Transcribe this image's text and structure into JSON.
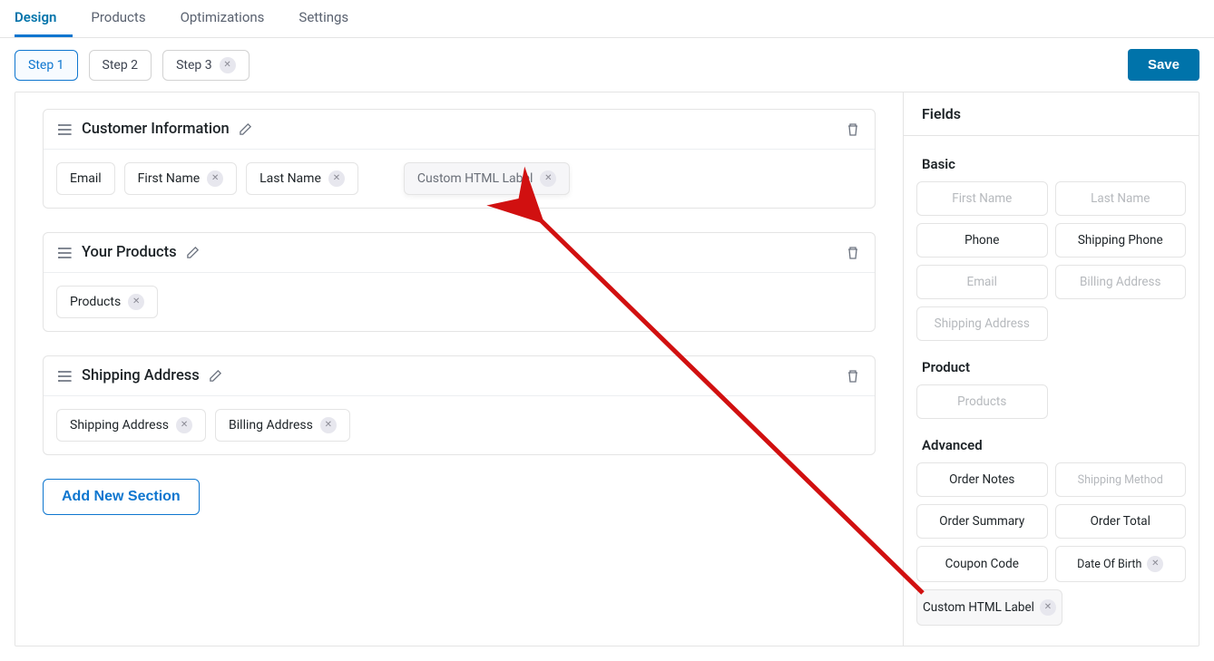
{
  "tabs": [
    "Design",
    "Products",
    "Optimizations",
    "Settings"
  ],
  "active_tab": "Design",
  "steps": [
    {
      "label": "Step 1",
      "closable": false
    },
    {
      "label": "Step 2",
      "closable": false
    },
    {
      "label": "Step 3",
      "closable": true
    }
  ],
  "active_step": "Step 1",
  "save_label": "Save",
  "add_section_label": "Add New Section",
  "sections": [
    {
      "title": "Customer Information",
      "chips": [
        {
          "label": "Email",
          "closable": false
        },
        {
          "label": "First Name",
          "closable": true
        },
        {
          "label": "Last Name",
          "closable": true
        }
      ],
      "dragging_chip": {
        "label": "Custom HTML Label",
        "closable": true
      }
    },
    {
      "title": "Your Products",
      "chips": [
        {
          "label": "Products",
          "closable": true
        }
      ]
    },
    {
      "title": "Shipping Address",
      "chips": [
        {
          "label": "Shipping Address",
          "closable": true
        },
        {
          "label": "Billing Address",
          "closable": true
        }
      ]
    }
  ],
  "right": {
    "title": "Fields",
    "groups": [
      {
        "label": "Basic",
        "items": [
          {
            "label": "First Name",
            "disabled": true
          },
          {
            "label": "Last Name",
            "disabled": true
          },
          {
            "label": "Phone",
            "disabled": false
          },
          {
            "label": "Shipping Phone",
            "disabled": false
          },
          {
            "label": "Email",
            "disabled": true
          },
          {
            "label": "Billing Address",
            "disabled": true
          },
          {
            "label": "Shipping Address",
            "disabled": true
          }
        ]
      },
      {
        "label": "Product",
        "items": [
          {
            "label": "Products",
            "disabled": true
          }
        ]
      },
      {
        "label": "Advanced",
        "items": [
          {
            "label": "Order Notes",
            "disabled": false
          },
          {
            "label": "Shipping Method",
            "disabled": true
          },
          {
            "label": "Order Summary",
            "disabled": false
          },
          {
            "label": "Order Total",
            "disabled": false
          },
          {
            "label": "Coupon Code",
            "disabled": false
          },
          {
            "label": "Date Of Birth",
            "disabled": false,
            "closable": true
          },
          {
            "label": "Custom HTML Label",
            "disabled": false,
            "closable": true,
            "selected": true
          }
        ]
      }
    ]
  },
  "colors": {
    "accent": "#0e76cf",
    "arrow": "#d11010"
  }
}
